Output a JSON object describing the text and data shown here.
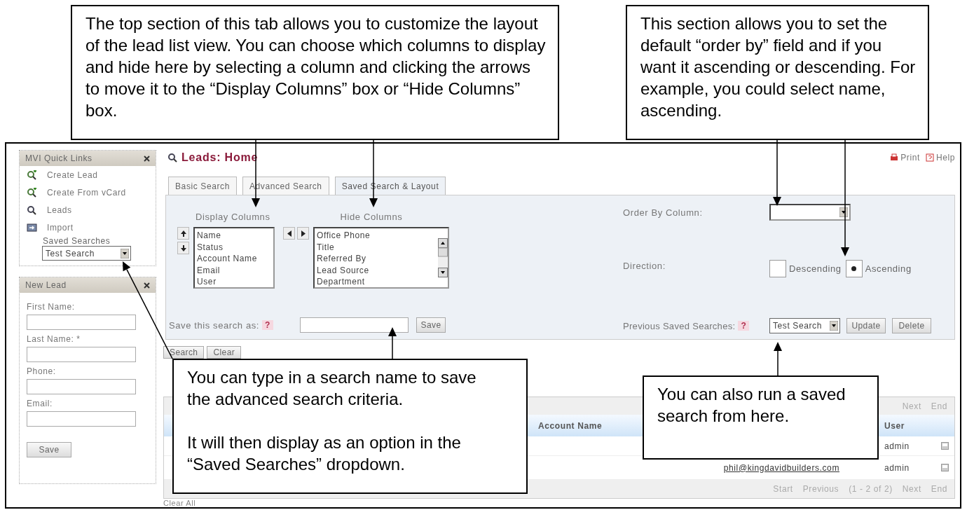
{
  "callouts": [
    {
      "paragraphs": [
        "The top section of this tab allows you to customize the layout of the lead list view. You can choose which columns to display and hide here by selecting a column and clicking the arrows to move it to the “Display Columns” box or “Hide Columns” box."
      ]
    },
    {
      "paragraphs": [
        "This section allows you to set the default “order by” field and if you want it ascending or descending. For example, you could select name, ascending."
      ]
    },
    {
      "paragraphs": [
        "You can type in a search name to save the advanced search criteria.",
        "It will then display as an option in the “Saved Searches” dropdown."
      ]
    },
    {
      "paragraphs": [
        "You can also run a saved search from here."
      ]
    }
  ],
  "sidebar": {
    "quick_links": {
      "title": "MVI Quick Links",
      "items": [
        {
          "label": "Create Lead",
          "kind": "add"
        },
        {
          "label": "Create From vCard",
          "kind": "add"
        },
        {
          "label": "Leads",
          "kind": "search"
        },
        {
          "label": "Import",
          "kind": "import"
        }
      ],
      "saved_searches_label": "Saved Searches",
      "saved_search_value": "Test Search"
    },
    "new_lead": {
      "title": "New Lead",
      "fields": [
        {
          "label": "First Name:"
        },
        {
          "label": "Last Name: *"
        },
        {
          "label": "Phone:"
        },
        {
          "label": "Email:"
        }
      ],
      "button": "Save"
    }
  },
  "header": {
    "title": "Leads: Home",
    "actions": [
      "Print",
      "Help"
    ]
  },
  "tabs": [
    {
      "label": "Basic Search",
      "selected": false
    },
    {
      "label": "Advanced Search",
      "selected": false
    },
    {
      "label": "Saved Search & Layout",
      "selected": true
    }
  ],
  "layout": {
    "display_label": "Display Columns",
    "hide_label": "Hide Columns",
    "display_columns": [
      "Name",
      "Status",
      "Account Name",
      "Email",
      "User"
    ],
    "hide_columns": [
      "Office Phone",
      "Title",
      "Referred By",
      "Lead Source",
      "Department"
    ],
    "save_label": "Save this search as:",
    "help_mark": "?",
    "save_button": "Save"
  },
  "order": {
    "order_label": "Order By Column:",
    "direction_label": "Direction:",
    "directions": [
      {
        "label": "Descending",
        "selected": false
      },
      {
        "label": "Ascending",
        "selected": true
      }
    ],
    "previous_label": "Previous Saved Searches:",
    "help_mark": "?",
    "previous_value": "Test Search",
    "buttons": [
      "Update",
      "Delete"
    ]
  },
  "search_buttons": [
    "Search",
    "Clear"
  ],
  "list": {
    "top_pager": [
      "Next",
      "End"
    ],
    "columns": [
      "Account Name",
      "User"
    ],
    "rows": [
      {
        "email": "",
        "user": "admin"
      },
      {
        "email": "phil@kingdavidbuilders.com",
        "user": "admin"
      }
    ],
    "bottom_pager": [
      "Start",
      "Previous",
      "(1 - 2 of 2)",
      "Next",
      "End"
    ]
  },
  "clear_all": "Clear All"
}
